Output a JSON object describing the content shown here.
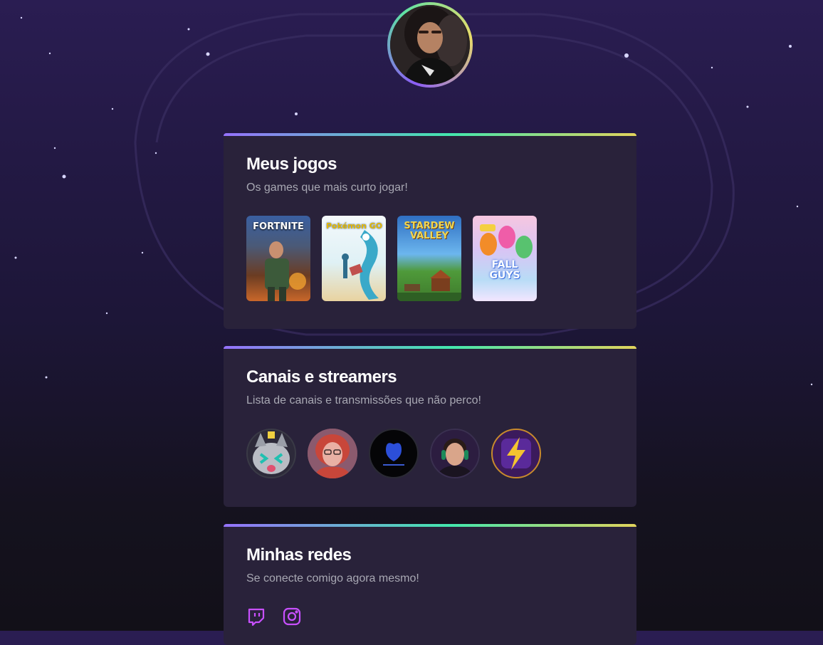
{
  "profile": {
    "avatar_icon": "profile-photo"
  },
  "sections": {
    "games": {
      "title": "Meus jogos",
      "subtitle": "Os games que mais curto jogar!",
      "items": [
        {
          "label": "FORTNITE"
        },
        {
          "label": "Pokémon GO"
        },
        {
          "label": "STARDEW VALLEY"
        },
        {
          "label": "FALL GUYS"
        }
      ]
    },
    "streamers": {
      "title": "Canais e streamers",
      "subtitle": "Lista de canais e transmissões que não perco!",
      "items": [
        {
          "avatar": "cat-mascot"
        },
        {
          "avatar": "red-hair-streamer"
        },
        {
          "avatar": "blue-logo"
        },
        {
          "avatar": "headset-streamer"
        },
        {
          "avatar": "lightning-logo"
        }
      ]
    },
    "socials": {
      "title": "Minhas redes",
      "subtitle": "Se conecte comigo agora mesmo!",
      "items": [
        {
          "icon": "twitch-icon"
        },
        {
          "icon": "instagram-icon"
        }
      ]
    }
  },
  "colors": {
    "accent_gradient": [
      "#9572fc",
      "#43e7ad",
      "#e2d45c"
    ],
    "card_bg": "#29223a",
    "social_icon": "#c850ff"
  }
}
